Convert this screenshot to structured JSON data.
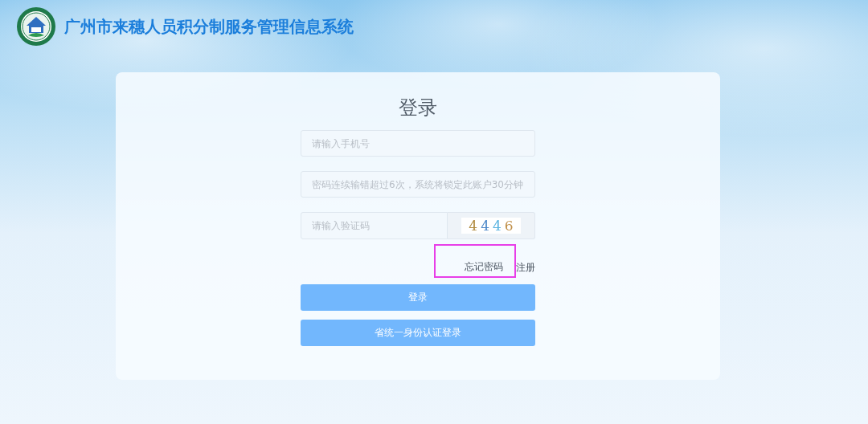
{
  "header": {
    "title": "广州市来穗人员积分制服务管理信息系统"
  },
  "login": {
    "title": "登录",
    "phone": {
      "placeholder": "请输入手机号"
    },
    "password": {
      "placeholder": "密码连续输错超过6次，系统将锁定此账户30分钟"
    },
    "captcha": {
      "placeholder": "请输入验证码",
      "code": "4446"
    },
    "links": [
      {
        "label": "忘记密码",
        "highlighted": true
      },
      {
        "label": "注册",
        "highlighted": false
      }
    ],
    "buttons": [
      "登录",
      "省统一身份认证登录"
    ]
  }
}
